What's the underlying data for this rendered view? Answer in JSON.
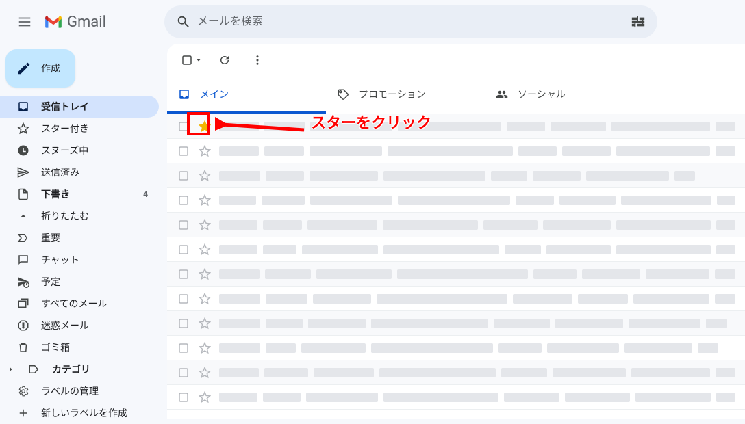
{
  "header": {
    "app_name": "Gmail",
    "search_placeholder": "メールを検索"
  },
  "compose_label": "作成",
  "sidebar": {
    "items": [
      {
        "key": "inbox",
        "label": "受信トレイ",
        "active": true,
        "bold": true
      },
      {
        "key": "starred",
        "label": "スター付き"
      },
      {
        "key": "snoozed",
        "label": "スヌーズ中"
      },
      {
        "key": "sent",
        "label": "送信済み"
      },
      {
        "key": "drafts",
        "label": "下書き",
        "bold": true,
        "count": "4"
      },
      {
        "key": "collapse",
        "label": "折りたたむ"
      },
      {
        "key": "important",
        "label": "重要"
      },
      {
        "key": "chat",
        "label": "チャット"
      },
      {
        "key": "scheduled",
        "label": "予定"
      },
      {
        "key": "allmail",
        "label": "すべてのメール"
      },
      {
        "key": "spam",
        "label": "迷惑メール"
      },
      {
        "key": "trash",
        "label": "ゴミ箱"
      },
      {
        "key": "categories",
        "label": "カテゴリ",
        "bold": true,
        "caret": true
      },
      {
        "key": "manage",
        "label": "ラベルの管理"
      },
      {
        "key": "newlabel",
        "label": "新しいラベルを作成"
      }
    ]
  },
  "tabs": [
    {
      "key": "primary",
      "label": "メイン",
      "active": true
    },
    {
      "key": "promotions",
      "label": "プロモーション"
    },
    {
      "key": "social",
      "label": "ソーシャル"
    }
  ],
  "row_count": 12,
  "annotation": {
    "text": "スターをクリック"
  }
}
